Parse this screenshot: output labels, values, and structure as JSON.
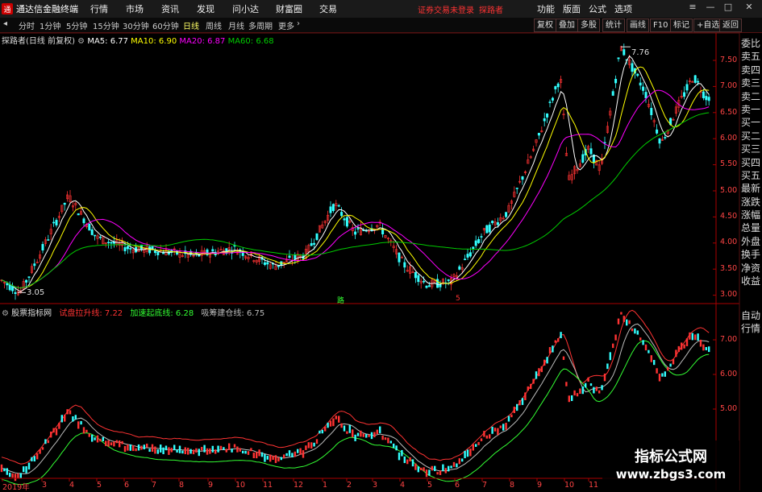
{
  "app": {
    "title": "通达信金融终端",
    "logo_text": "通"
  },
  "menu": [
    "行情",
    "市场",
    "资讯",
    "发现",
    "问小达",
    "财富圈",
    "交易"
  ],
  "promo": {
    "text1": "证券交易未登录",
    "text2": "探路者"
  },
  "right_menu": [
    "功能",
    "版面",
    "公式",
    "选项"
  ],
  "periods": [
    "分时",
    "1分钟",
    "5分钟",
    "15分钟",
    "30分钟",
    "60分钟",
    "日线",
    "周线",
    "月线",
    "多周期",
    "更多"
  ],
  "active_period": "日线",
  "toolbar_right": [
    "复权",
    "叠加",
    "多股",
    "统计",
    "画线",
    "F10",
    "标记",
    "+自选",
    "返回"
  ],
  "main_legend": {
    "stock": "探路者(日线 前复权)",
    "ma5": "MA5: 6.77",
    "ma10": "MA10: 6.90",
    "ma20": "MA20: 6.87",
    "ma60": "MA60: 6.68"
  },
  "indicator_legend": {
    "name": "股票指标网",
    "l1_label": "试盘拉升线:",
    "l1_val": "7.22",
    "l2_label": "加速起底线:",
    "l2_val": "6.28",
    "l3_label": "吸筹建仓线:",
    "l3_val": "6.75"
  },
  "sidebar_items": [
    "委比",
    "卖五",
    "卖四",
    "卖三",
    "卖二",
    "卖一",
    "买一",
    "买二",
    "买三",
    "买四",
    "买五",
    "最新",
    "涨跌",
    "涨幅",
    "总量",
    "外盘",
    "换手",
    "净资",
    "收益"
  ],
  "sidebar_bottom": [
    "自动",
    "行情"
  ],
  "price_axis": [
    "7.50",
    "7.00",
    "6.50",
    "6.00",
    "5.50",
    "5.00",
    "4.50",
    "4.00",
    "3.50",
    "3.00"
  ],
  "indicator_axis": [
    "7.00",
    "6.00",
    "5.00"
  ],
  "date_axis": [
    "2019年",
    "3",
    "4",
    "5",
    "6",
    "7",
    "8",
    "9",
    "10",
    "11",
    "12",
    "1",
    "2",
    "3",
    "4",
    "5",
    "6",
    "7",
    "8",
    "9",
    "10",
    "11"
  ],
  "annotations": {
    "high": "7.76",
    "low": "3.05",
    "marker1": "路",
    "marker2": "5"
  },
  "watermark": {
    "line1": "指标公式网",
    "line2": "www.zbgs3.com"
  },
  "colors": {
    "up": "#ff3333",
    "down": "#33ffff",
    "ma5": "#ffffff",
    "ma10": "#ffff00",
    "ma20": "#ff00ff",
    "ma60": "#00cc00",
    "axis": "#aa0000"
  }
}
